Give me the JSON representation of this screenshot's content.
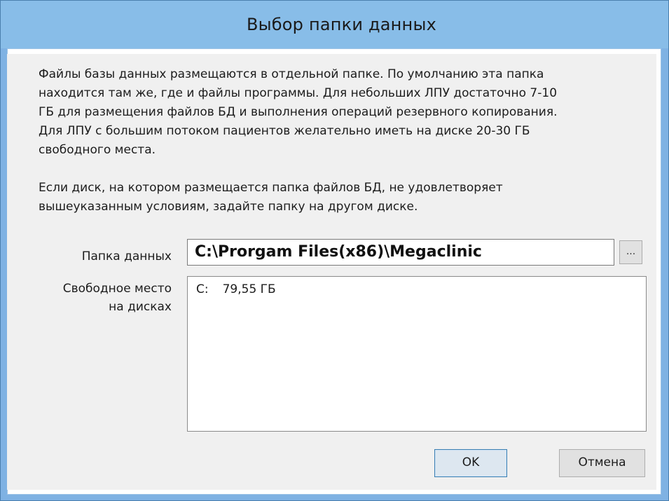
{
  "window": {
    "title": "Выбор папки данных"
  },
  "description": {
    "paragraph1_lines": [
      "Файлы базы данных размещаются в отдельной папке. По умолчанию эта папка",
      "находится там же, где и файлы программы. Для небольших ЛПУ достаточно 7-10",
      "ГБ для размещения файлов БД и выполнения операций резервного копирования.",
      "Для ЛПУ с большим потоком пациентов желательно иметь на диске 20-30 ГБ",
      "свободного места."
    ],
    "paragraph2_lines": [
      "Если диск, на котором размещается папка файлов БД, не удовлетворяет",
      "вышеуказанным условиям, задайте папку на другом диске."
    ]
  },
  "form": {
    "folder_label": "Папка данных",
    "folder_value": "C:\\Prorgam Files(x86)\\Megaclinic",
    "browse_label": "...",
    "free_space_label_line1": "Свободное место",
    "free_space_label_line2": "на дисках",
    "disks": [
      {
        "drive": "C:",
        "free": "79,55 ГБ"
      }
    ]
  },
  "buttons": {
    "ok_label": "OK",
    "cancel_label": "Отмена"
  },
  "colors": {
    "titlebar": "#88bde8",
    "dialog_background": "#f0f0f0",
    "default_button_border": "#3c7fb1"
  }
}
